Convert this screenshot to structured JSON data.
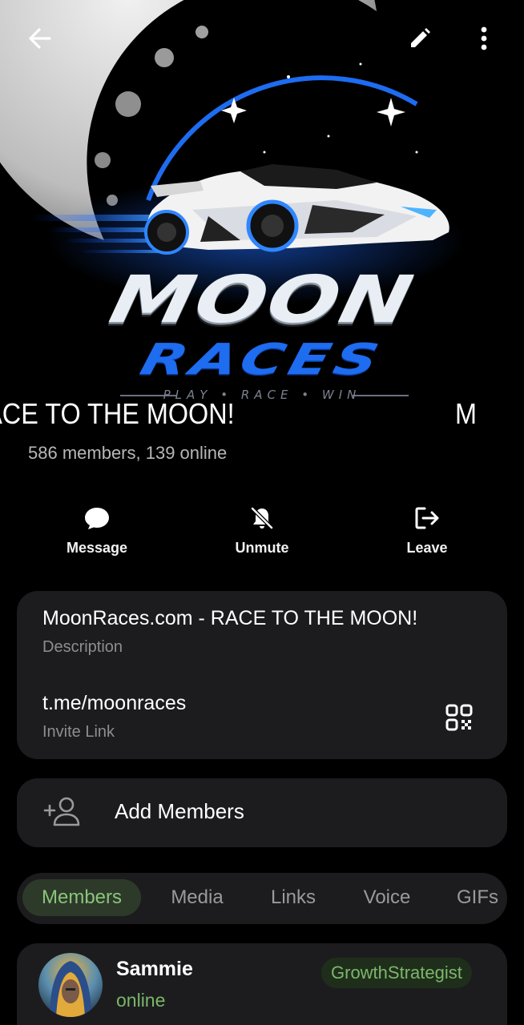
{
  "topbar": {
    "back_icon": "arrow-left-icon",
    "edit_icon": "pencil-icon",
    "more_icon": "more-vertical-icon"
  },
  "cover": {
    "logo_line1": "MOON",
    "logo_line2": "RACES",
    "logo_tagline": "PLAY • RACE • WIN"
  },
  "group": {
    "title": "MoonRaces.com - RACE TO THE MOON!",
    "title_visible": "om - RACE TO THE MOON!",
    "title_loop_visible": "M",
    "members_text": "586 members, 139 online"
  },
  "actions": [
    {
      "label": "Message",
      "icon": "chat-bubble-icon"
    },
    {
      "label": "Unmute",
      "icon": "bell-off-icon"
    },
    {
      "label": "Leave",
      "icon": "leave-icon"
    }
  ],
  "info": {
    "description_value": "MoonRaces.com - RACE TO THE MOON!",
    "description_label": "Description",
    "invite_value": "t.me/moonraces",
    "invite_label": "Invite Link",
    "qr_icon": "qr-code-icon"
  },
  "add_members": {
    "label": "Add Members",
    "icon": "add-person-icon"
  },
  "tabs": [
    {
      "label": "Members",
      "active": true
    },
    {
      "label": "Media",
      "active": false
    },
    {
      "label": "Links",
      "active": false
    },
    {
      "label": "Voice",
      "active": false
    },
    {
      "label": "GIFs",
      "active": false
    }
  ],
  "members": [
    {
      "name": "Sammie",
      "status": "online",
      "badge": "GrowthStrategist"
    }
  ],
  "colors": {
    "background": "#000000",
    "card": "#1c1c1e",
    "accent_green": "#8bc47a",
    "online_green": "#79b768",
    "logo_blue": "#1e6cf0"
  }
}
